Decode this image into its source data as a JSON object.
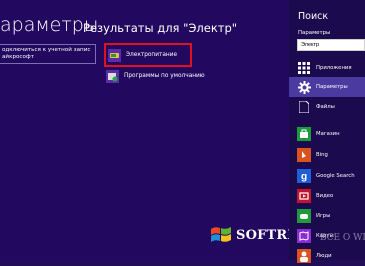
{
  "main": {
    "title": "араметры",
    "results_title": "Результаты для \"Электр\"",
    "results": [
      {
        "label": "одключиться к учетной запис\nайкрософт"
      },
      {
        "label": "Электропитание"
      },
      {
        "label": "Программы по умолчанию"
      }
    ]
  },
  "sidebar": {
    "title": "Поиск",
    "scope": "Параметры",
    "query": "Электр",
    "categories": [
      {
        "label": "Приложения",
        "icon": "apps-icon"
      },
      {
        "label": "Параметры",
        "icon": "gear-icon"
      },
      {
        "label": "Файлы",
        "icon": "files-icon"
      },
      {
        "label": "Магазин",
        "icon": "store-icon"
      },
      {
        "label": "Bing",
        "icon": "bing-icon"
      },
      {
        "label": "Google Search",
        "icon": "google-search-icon"
      },
      {
        "label": "Видео",
        "icon": "video-icon"
      },
      {
        "label": "Игры",
        "icon": "games-icon"
      },
      {
        "label": "Карты",
        "icon": "maps-icon"
      },
      {
        "label": "Люди",
        "icon": "people-icon"
      }
    ]
  },
  "watermark": {
    "text": "SOFTREW.RU",
    "faint": "ВСЕ О WIN"
  },
  "colors": {
    "background": "#23085f",
    "sidebar": "#1c0a4f",
    "highlight": "#e0101e",
    "active": "#4b3ba0"
  }
}
